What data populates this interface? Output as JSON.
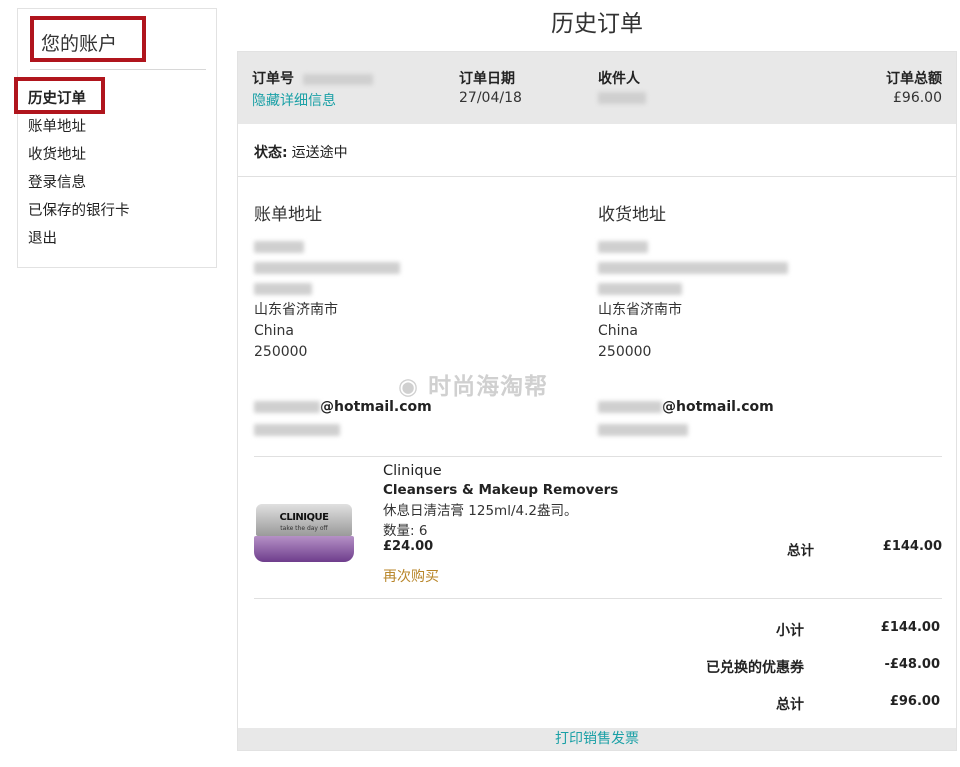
{
  "sidebar": {
    "title": "您的账户",
    "items": [
      {
        "label": "历史订单",
        "active": true
      },
      {
        "label": "账单地址"
      },
      {
        "label": "收货地址"
      },
      {
        "label": "登录信息"
      },
      {
        "label": "已保存的银行卡"
      },
      {
        "label": "退出"
      }
    ]
  },
  "page": {
    "title": "历史订单"
  },
  "order": {
    "number_label": "订单号",
    "toggle_details": "隐藏详细信息",
    "date_label": "订单日期",
    "date": "27/04/18",
    "recipient_label": "收件人",
    "total_label": "订单总额",
    "total": "£96.00",
    "status_label": "状态:",
    "status": "运送途中"
  },
  "billing": {
    "heading": "账单地址",
    "province_city": "山东省济南市",
    "country": "China",
    "postcode": "250000",
    "email_suffix": "@hotmail.com"
  },
  "shipping": {
    "heading": "收货地址",
    "province_city": "山东省济南市",
    "country": "China",
    "postcode": "250000",
    "email_suffix": "@hotmail.com"
  },
  "watermark": "时尚海淘帮",
  "product": {
    "brand": "Clinique",
    "name": "Cleansers & Makeup Removers",
    "description": "休息日清洁膏 125ml/4.2盎司。",
    "quantity": "数量: 6",
    "price": "£24.00",
    "reorder": "再次购买",
    "total_label": "总计",
    "total": "£144.00",
    "jar_brand": "CLINIQUE",
    "jar_sub": "take the day off"
  },
  "summary": {
    "subtotal_label": "小计",
    "subtotal": "£144.00",
    "coupon_label": "已兑换的优惠券",
    "coupon": "-£48.00",
    "grand_label": "总计",
    "grand": "£96.00"
  },
  "print_invoice": "打印销售发票",
  "colors": {
    "highlight_border": "#b0151d",
    "link_teal": "#1aa0a6",
    "reorder_gold": "#b8862a",
    "header_gray": "#e8e8e8"
  }
}
